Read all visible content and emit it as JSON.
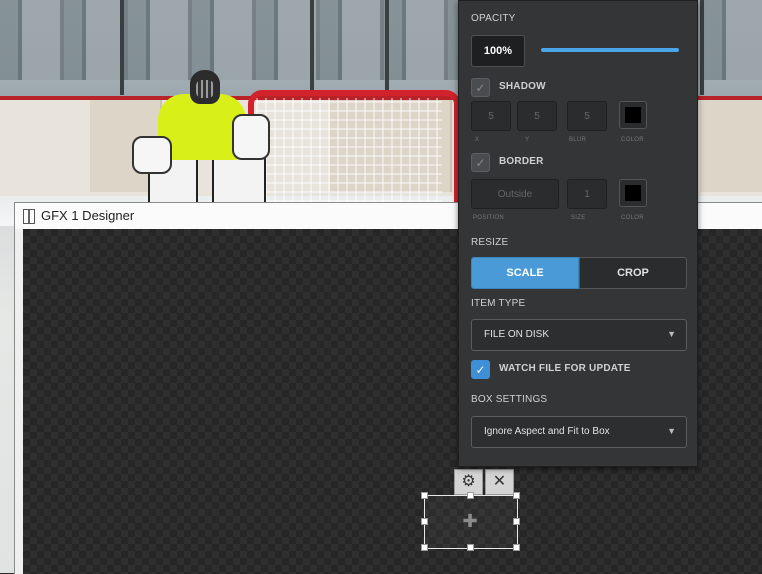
{
  "designer": {
    "title": "GFX 1 Designer"
  },
  "panel": {
    "opacity": {
      "label": "OPACITY",
      "value": "100%",
      "level": 1.0
    },
    "shadow": {
      "label": "SHADOW",
      "checked": false,
      "x_value": "5",
      "y_value": "5",
      "blur_value": "5",
      "x_label": "X",
      "y_label": "Y",
      "blur_label": "BLUR",
      "color_label": "COLOR",
      "color": "#000000"
    },
    "border": {
      "label": "BORDER",
      "checked": false,
      "position_value": "Outside",
      "size_value": "1",
      "position_label": "POSITION",
      "size_label": "SIZE",
      "color_label": "COLOR",
      "color": "#000000"
    },
    "resize": {
      "label": "RESIZE",
      "scale_label": "SCALE",
      "crop_label": "CROP",
      "selected": "SCALE"
    },
    "item_type": {
      "label": "ITEM TYPE",
      "value": "FILE ON DISK"
    },
    "watch_file": {
      "label": "WATCH FILE FOR UPDATE",
      "checked": true
    },
    "box_settings": {
      "label": "BOX SETTINGS",
      "value": "Ignore Aspect and Fit to Box"
    }
  },
  "item_tools": {
    "settings_icon": "gear-icon",
    "close_icon": "close-icon"
  },
  "colors": {
    "accent": "#4a9ad8",
    "panel_bg": "#333537",
    "goalie_jersey": "#d9ef18",
    "goal_frame": "#d2222b"
  }
}
